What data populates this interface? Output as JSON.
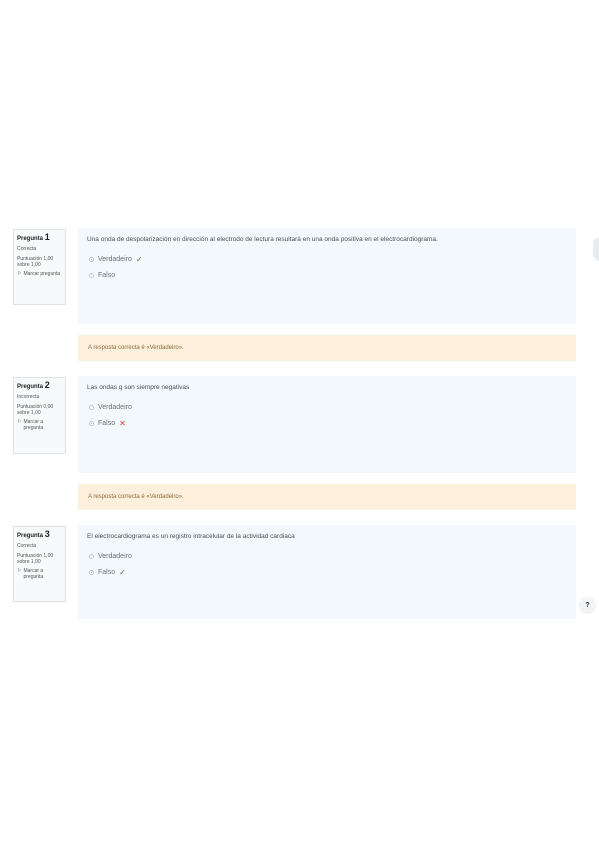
{
  "questions": [
    {
      "label": "Pregunta",
      "number": "1",
      "state": "Correcta",
      "grade": "Puntuación 1,00 sobre 1,00",
      "flag": "Marcar pregunta",
      "text": "Una onda de despolarización en dirección al electrodo de lectura resultará en una onda positiva en el electrocardiograma.",
      "options": [
        {
          "label": "Verdadeiro",
          "selected": true,
          "mark": "✓"
        },
        {
          "label": "Falso",
          "selected": false,
          "mark": ""
        }
      ],
      "feedback": "A resposta correcta é «Verdadeiro»."
    },
    {
      "label": "Pregunta",
      "number": "2",
      "state": "Incorrecta",
      "grade": "Puntuación 0,00 sobre 1,00",
      "flag": "Marcar a pregunta",
      "text": "Las ondas q son siempre negativas",
      "options": [
        {
          "label": "Verdadeiro",
          "selected": false,
          "mark": ""
        },
        {
          "label": "Falso",
          "selected": true,
          "mark": "✕"
        }
      ],
      "feedback": "A resposta correcta é «Verdadeiro»."
    },
    {
      "label": "Pregunta",
      "number": "3",
      "state": "Correcta",
      "grade": "Puntuación 1,00 sobre 1,00",
      "flag": "Marcar a pregunta",
      "text": "El electrocardiograma es un registro intracelular de la actividad cardiaca",
      "options": [
        {
          "label": "Verdadeiro",
          "selected": false,
          "mark": ""
        },
        {
          "label": "Falso",
          "selected": true,
          "mark": "✓"
        }
      ]
    }
  ],
  "help": "?"
}
